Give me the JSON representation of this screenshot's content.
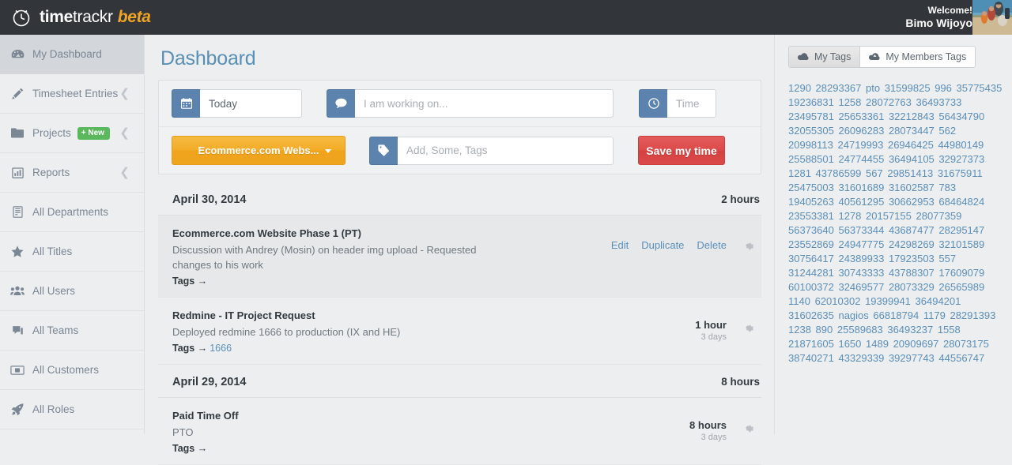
{
  "brand": {
    "part1": "time",
    "part2": "trackr",
    "part3": "beta",
    "clock_icon": "clock-icon"
  },
  "header": {
    "welcome_label": "Welcome!",
    "user_name": "Bimo Wijoyo",
    "avatar": "user-avatar"
  },
  "sidebar": {
    "items": [
      {
        "label": "My Dashboard",
        "icon": "dashboard-icon",
        "active": true,
        "chevron": false,
        "badge": null
      },
      {
        "label": "Timesheet Entries",
        "icon": "pencil-icon",
        "active": false,
        "chevron": true,
        "badge": null
      },
      {
        "label": "Projects",
        "icon": "folder-icon",
        "active": false,
        "chevron": true,
        "badge": "+ New"
      },
      {
        "label": "Reports",
        "icon": "bar-chart-icon",
        "active": false,
        "chevron": true,
        "badge": null
      },
      {
        "label": "All Departments",
        "icon": "building-icon",
        "active": false,
        "chevron": false,
        "badge": null
      },
      {
        "label": "All Titles",
        "icon": "star-icon",
        "active": false,
        "chevron": false,
        "badge": null
      },
      {
        "label": "All Users",
        "icon": "users-icon",
        "active": false,
        "chevron": false,
        "badge": null
      },
      {
        "label": "All Teams",
        "icon": "team-icon",
        "active": false,
        "chevron": false,
        "badge": null
      },
      {
        "label": "All Customers",
        "icon": "money-icon",
        "active": false,
        "chevron": false,
        "badge": null
      },
      {
        "label": "All Roles",
        "icon": "rocket-icon",
        "active": false,
        "chevron": false,
        "badge": null
      }
    ]
  },
  "main": {
    "page_title": "Dashboard",
    "form": {
      "date_icon": "calendar-icon",
      "date_value": "Today",
      "work_icon": "comment-icon",
      "work_placeholder": "I am working on...",
      "time_icon": "clock-icon",
      "time_placeholder": "Time",
      "project_button": "Ecommerce.com Webs...",
      "tag_icon": "tag-icon",
      "tags_placeholder": "Add, Some, Tags",
      "save_button": "Save my time"
    },
    "days": [
      {
        "date": "April 30, 2014",
        "total": "2 hours",
        "entries": [
          {
            "title": "Ecommerce.com Website Phase 1 (PT)",
            "description": "Discussion with Andrey (Mosin) on header img upload - Requested changes to his work",
            "tags_label": "Tags →",
            "tags_value": "",
            "highlighted": true,
            "actions": [
              "Edit",
              "Duplicate",
              "Delete"
            ],
            "hours": "",
            "ago": "",
            "gear": "gear-icon"
          },
          {
            "title": "Redmine - IT Project Request",
            "description": "Deployed redmine 1666 to production (IX and HE)",
            "tags_label": "Tags →",
            "tags_value": "1666",
            "highlighted": false,
            "actions": [],
            "hours": "1 hour",
            "ago": "3 days",
            "gear": "gear-icon"
          }
        ]
      },
      {
        "date": "April 29, 2014",
        "total": "8 hours",
        "entries": [
          {
            "title": "Paid Time Off",
            "description": "PTO",
            "tags_label": "Tags →",
            "tags_value": "",
            "highlighted": false,
            "actions": [],
            "hours": "8 hours",
            "ago": "3 days",
            "gear": "gear-icon"
          }
        ]
      }
    ]
  },
  "right_panel": {
    "tabs": [
      {
        "label": "My Tags",
        "icon": "cloud-filled-icon",
        "active": true
      },
      {
        "label": "My Members Tags",
        "icon": "cloud-upload-icon",
        "active": false
      }
    ],
    "tags": [
      "1290",
      "28293367",
      "pto",
      "31599825",
      "996",
      "35775435",
      "19236831",
      "1258",
      "28072763",
      "36493733",
      "23495781",
      "25653361",
      "32212843",
      "56434790",
      "32055305",
      "26096283",
      "28073447",
      "562",
      "20998113",
      "24719993",
      "26946425",
      "44980149",
      "25588501",
      "24774455",
      "36494105",
      "32927373",
      "1281",
      "43786599",
      "567",
      "29851413",
      "31675911",
      "25475003",
      "31601689",
      "31602587",
      "783",
      "19405263",
      "40561295",
      "30662953",
      "68464824",
      "23553381",
      "1278",
      "20157155",
      "28077359",
      "56373640",
      "56373344",
      "43687477",
      "28295147",
      "23552869",
      "24947775",
      "24298269",
      "32101589",
      "30756417",
      "24389933",
      "17923503",
      "557",
      "31244281",
      "30743333",
      "43788307",
      "17609079",
      "60100372",
      "32469577",
      "28073329",
      "26565989",
      "1140",
      "62010302",
      "19399941",
      "36494201",
      "31602635",
      "nagios",
      "66818794",
      "1179",
      "28291393",
      "1238",
      "890",
      "25589683",
      "36493237",
      "1558",
      "21871605",
      "1650",
      "1489",
      "20909697",
      "28073175",
      "38740271",
      "43329339",
      "39297743",
      "44556747"
    ]
  },
  "colors": {
    "topbar": "#32363b",
    "brand_accent": "#f0a426",
    "title_blue": "#5a8fb5",
    "addon_blue": "#5b83ad",
    "project_orange": "#f3ab27",
    "save_red": "#d64141",
    "badge_green": "#5cb85c",
    "link_blue": "#5b8fb9"
  }
}
